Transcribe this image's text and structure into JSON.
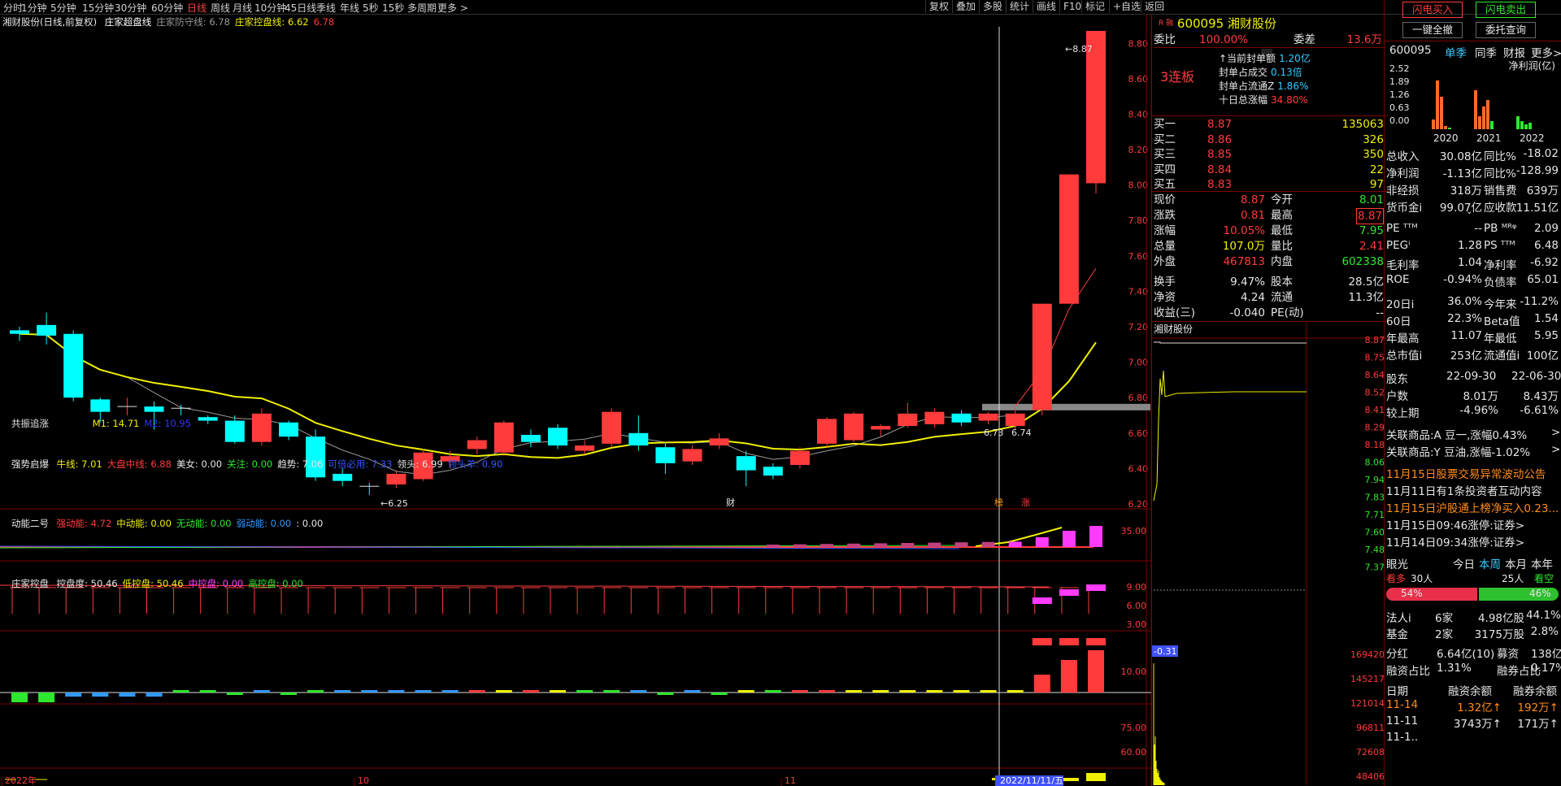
{
  "toolbar": {
    "periods": [
      "分时",
      "1分钟",
      "5分钟",
      "15分钟",
      "30分钟",
      "60分钟",
      "日线",
      "周线",
      "月线",
      "10分钟",
      "45日线",
      "季线",
      "年线",
      "5秒",
      "15秒",
      "多周期",
      "更多 >"
    ],
    "selected": "日线",
    "right_buttons": [
      "复权",
      "叠加",
      "多股",
      "统计",
      "画线",
      "F10",
      "标记",
      "+自选",
      "返回"
    ]
  },
  "chart": {
    "title": "湘财股份(日线,前复权)",
    "ma_legend": [
      {
        "label": "庄家超盘线",
        "color": "#ffffff"
      },
      {
        "label": "庄家防守线: 6.78",
        "color": "#9a9a9a"
      },
      {
        "label": "庄家控盘线: 6.62",
        "color": "#f0f000"
      },
      {
        "label": "6.78",
        "color": "#ff3b3b"
      }
    ],
    "price_axis": [
      "8.80",
      "8.60",
      "8.40",
      "8.20",
      "8.00",
      "7.80",
      "7.60",
      "7.40",
      "7.20",
      "7.00",
      "6.80",
      "6.60",
      "6.40",
      "6.20"
    ],
    "annotations": {
      "high": "8.87",
      "low": "6.25",
      "left_price": "6.73",
      "right_price": "6.74",
      "marker_cai": "财",
      "marker_ban": "榜",
      "marker_zhang": "涨"
    },
    "x_labels": [
      "2022年",
      "10",
      "11"
    ],
    "date_cursor": "2022/11/11/五",
    "period_label": "日线",
    "candles": [
      [
        7.18,
        7.16,
        7.2,
        7.12
      ],
      [
        7.21,
        7.15,
        7.28,
        7.1
      ],
      [
        7.16,
        6.8,
        7.18,
        6.78
      ],
      [
        6.79,
        6.72,
        6.8,
        6.66
      ],
      [
        6.75,
        6.75,
        6.8,
        6.7
      ],
      [
        6.75,
        6.72,
        6.78,
        6.62
      ],
      [
        6.74,
        6.73,
        6.76,
        6.7
      ],
      [
        6.69,
        6.67,
        6.7,
        6.65
      ],
      [
        6.67,
        6.55,
        6.7,
        6.54
      ],
      [
        6.55,
        6.71,
        6.74,
        6.53
      ],
      [
        6.66,
        6.58,
        6.67,
        6.56
      ],
      [
        6.58,
        6.35,
        6.62,
        6.33
      ],
      [
        6.37,
        6.33,
        6.4,
        6.3
      ],
      [
        6.3,
        6.29,
        6.32,
        6.25
      ],
      [
        6.31,
        6.37,
        6.39,
        6.29
      ],
      [
        6.34,
        6.49,
        6.51,
        6.33
      ],
      [
        6.44,
        6.47,
        6.5,
        6.4
      ],
      [
        6.51,
        6.56,
        6.58,
        6.48
      ],
      [
        6.49,
        6.66,
        6.67,
        6.47
      ],
      [
        6.59,
        6.55,
        6.62,
        6.52
      ],
      [
        6.63,
        6.53,
        6.65,
        6.51
      ],
      [
        6.5,
        6.53,
        6.56,
        6.48
      ],
      [
        6.54,
        6.72,
        6.74,
        6.52
      ],
      [
        6.6,
        6.53,
        6.7,
        6.5
      ],
      [
        6.52,
        6.43,
        6.55,
        6.37
      ],
      [
        6.44,
        6.51,
        6.53,
        6.42
      ],
      [
        6.53,
        6.57,
        6.6,
        6.51
      ],
      [
        6.47,
        6.39,
        6.5,
        6.3
      ],
      [
        6.41,
        6.36,
        6.43,
        6.34
      ],
      [
        6.42,
        6.5,
        6.52,
        6.4
      ],
      [
        6.54,
        6.68,
        6.69,
        6.52
      ],
      [
        6.56,
        6.71,
        6.72,
        6.55
      ],
      [
        6.62,
        6.64,
        6.65,
        6.58
      ],
      [
        6.64,
        6.71,
        6.77,
        6.63
      ],
      [
        6.65,
        6.72,
        6.74,
        6.63
      ],
      [
        6.71,
        6.66,
        6.73,
        6.64
      ],
      [
        6.67,
        6.71,
        6.72,
        6.65
      ],
      [
        6.64,
        6.71,
        6.74,
        6.62
      ],
      [
        6.73,
        7.33,
        7.33,
        6.7
      ],
      [
        7.33,
        8.06,
        8.06,
        7.33
      ],
      [
        8.01,
        8.87,
        8.87,
        7.95
      ]
    ]
  },
  "indicators": {
    "p1": {
      "name": "共振追涨",
      "items": [
        {
          "t": "M1: 14.71",
          "c": "#f0f000"
        },
        {
          "t": "M2: 10.95",
          "c": "#3333ff"
        }
      ],
      "axis": [
        "35.00"
      ]
    },
    "p2": {
      "name": "强势启爆",
      "items": [
        {
          "t": "牛线: 7.01",
          "c": "#f0f000"
        },
        {
          "t": "大盘中线: 6.88",
          "c": "#ff3b3b"
        },
        {
          "t": "美女: 0.00",
          "c": "#e6e6e6"
        },
        {
          "t": "关注: 0.00",
          "c": "#2ee82e"
        },
        {
          "t": "趋势: 7.06",
          "c": "#e6e6e6"
        },
        {
          "t": "可倍必用: 7.33",
          "c": "#3355ff"
        },
        {
          "t": "领头: 6.99",
          "c": "#e6e6e6"
        },
        {
          "t": "领头羊: 0.90",
          "c": "#3355ff"
        }
      ],
      "axis": [
        "9.00",
        "6.00",
        "3.00"
      ]
    },
    "p3": {
      "name": "动能二号",
      "items": [
        {
          "t": "强动能: 4.72",
          "c": "#ff3b3b"
        },
        {
          "t": "中动能: 0.00",
          "c": "#f0f000"
        },
        {
          "t": "无动能: 0.00",
          "c": "#2ee82e"
        },
        {
          "t": "弱动能: 0.00",
          "c": "#3399ff"
        },
        {
          "t": ": 0.00",
          "c": "#e6e6e6"
        }
      ],
      "axis": [
        "10.00"
      ]
    },
    "p4": {
      "name": "庄家控盘",
      "items": [
        {
          "t": "控盘度: 50.46",
          "c": "#e6e6e6"
        },
        {
          "t": "低控盘: 50.46",
          "c": "#f0f000"
        },
        {
          "t": "中控盘: 0.00",
          "c": "#ff3bff"
        },
        {
          "t": "高控盘: 0.00",
          "c": "#2ee82e"
        }
      ],
      "axis": [
        "75.00",
        "60.00"
      ]
    }
  },
  "quote": {
    "code": "600095",
    "name": "湘财股份",
    "marker": "R 融",
    "weibi_label": "委比",
    "weibi": "100.00%",
    "weicha_label": "委差",
    "weicha": "13.6万",
    "lianban": "3连板",
    "seal": [
      {
        "k": "↑当前封单额",
        "v": "1.20亿"
      },
      {
        "k": "封单占成交",
        "v": "0.13倍"
      },
      {
        "k": "封单占流通Z",
        "v": "1.86%"
      },
      {
        "k": "十日总涨幅",
        "v": "34.80%"
      }
    ],
    "bids": [
      {
        "k": "买一",
        "p": "8.87",
        "v": "135063"
      },
      {
        "k": "买二",
        "p": "8.86",
        "v": "326"
      },
      {
        "k": "买三",
        "p": "8.85",
        "v": "350"
      },
      {
        "k": "买四",
        "p": "8.84",
        "v": "22"
      },
      {
        "k": "买五",
        "p": "8.83",
        "v": "97"
      }
    ],
    "stats": [
      {
        "k1": "现价",
        "v1": "8.87",
        "k2": "今开",
        "v2": "8.01"
      },
      {
        "k1": "涨跌",
        "v1": "0.81",
        "k2": "最高",
        "v2": "8.87"
      },
      {
        "k1": "涨幅",
        "v1": "10.05%",
        "k2": "最低",
        "v2": "7.95"
      },
      {
        "k1": "总量",
        "v1": "107.0万",
        "k2": "量比",
        "v2": "2.41"
      },
      {
        "k1": "外盘",
        "v1": "467813",
        "k2": "内盘",
        "v2": "602338"
      },
      {
        "k1": "换手",
        "v1": "9.47%",
        "k2": "股本",
        "v2": "28.5亿"
      },
      {
        "k1": "净资",
        "v1": "4.24",
        "k2": "流通",
        "v2": "11.3亿"
      },
      {
        "k1": "收益(三)",
        "v1": "-0.040",
        "k2": "PE(动)",
        "v2": "--"
      }
    ],
    "mini_title": "湘财股份",
    "mini_axis": [
      "8.87",
      "8.75",
      "8.64",
      "8.52",
      "8.41",
      "8.29",
      "8.18",
      "8.06",
      "7.94",
      "7.83",
      "7.71",
      "7.60",
      "7.48",
      "7.37"
    ],
    "vol_axis": [
      "169420",
      "145217",
      "121014",
      "96811",
      "72608",
      "48406",
      "24203"
    ],
    "mini_tag": "-0.31"
  },
  "fin": {
    "btn_buy": "闪电买入",
    "btn_sell": "闪电卖出",
    "btn_clear": "一键全撤",
    "btn_query": "委托查询",
    "tabs": [
      "600095",
      "单季",
      "同季",
      "财报",
      "更多>>"
    ],
    "chart_caption": "净利润(亿)",
    "chart_axis": [
      "2.52",
      "1.89",
      "1.26",
      "0.63",
      "0.00"
    ],
    "chart_years": [
      "2020",
      "2021",
      "2022"
    ],
    "rows1": [
      {
        "a": "总收入",
        "b": "30.08亿",
        "c": "同比%",
        "d": "-18.02"
      },
      {
        "a": "净利润",
        "b": "-1.13亿",
        "c": "同比%",
        "d": "-128.99"
      },
      {
        "a": "非经损",
        "b": "318万",
        "c": "销售费",
        "d": "639万"
      },
      {
        "a": "货币金i",
        "b": "99.07亿",
        "c": "应收款",
        "d": "11.51亿"
      }
    ],
    "rows2": [
      {
        "a": "PE ᵀᵀᴹ",
        "b": "--",
        "c": "PB ᴹᴿᵠ",
        "d": "2.09"
      },
      {
        "a": "PEGⁱ",
        "b": "1.28",
        "c": "PS ᵀᵀᴹ",
        "d": "6.48"
      },
      {
        "a": "毛利率",
        "b": "1.04",
        "c": "净利率",
        "d": "-6.92"
      },
      {
        "a": "ROE",
        "b": "-0.94%",
        "c": "负债率",
        "d": "65.01"
      }
    ],
    "rows3": [
      {
        "a": "20日i",
        "b": "36.0%",
        "c": "今年来",
        "d": "-11.2%"
      },
      {
        "a": "60日",
        "b": "22.3%",
        "c": "Beta值",
        "d": "1.54"
      },
      {
        "a": "年最高",
        "b": "11.07",
        "c": "年最低",
        "d": "5.95"
      },
      {
        "a": "总市值i",
        "b": "253亿",
        "c": "流通值i",
        "d": "100亿"
      }
    ],
    "holders_head": {
      "a": "股东",
      "b": "22-09-30",
      "c": "22-06-30"
    },
    "holders": [
      {
        "a": "户数",
        "b": "8.01万",
        "c": "8.43万"
      },
      {
        "a": "较上期",
        "b": "-4.96%",
        "c": "-6.61%"
      }
    ],
    "related": [
      "关联商品:A 豆一,涨幅0.43%",
      "关联商品:Y 豆油,涨幅-1.02%"
    ],
    "news": [
      "11月15日股票交易异常波动公告",
      "11月11日有1条投资者互动内容",
      "11月15日沪股通上榜净买入0.23...",
      "11月15日09:46涨停:证券>",
      "11月14日09:34涨停:证券>"
    ],
    "eye": {
      "label": "眼光",
      "tabs": [
        "今日",
        "本周",
        "本月",
        "本年"
      ],
      "bull": "看多",
      "bull_n": "30人",
      "bear_n": "25人",
      "bear": "看空",
      "bull_pct": "54%",
      "bear_pct": "46%"
    },
    "inst": [
      {
        "a": "法人i",
        "b": "6家",
        "c": "4.98亿股",
        "d": "44.1%"
      },
      {
        "a": "基金",
        "b": "2家",
        "c": "3175万股",
        "d": "2.8%"
      }
    ],
    "div": {
      "a": "分红",
      "b": "6.64亿(10)",
      "c": "募资",
      "d": "138亿(5)"
    },
    "margin": {
      "a": "融资占比",
      "b": "1.31%",
      "c": "融券占比",
      "d": "0.17%"
    },
    "margin_head": {
      "a": "日期",
      "b": "融资余额",
      "c": "融券余额"
    },
    "margin_rows": [
      {
        "a": "11-14",
        "b": "1.32亿↑",
        "c": "192万↑"
      },
      {
        "a": "11-11",
        "b": "3743万↑",
        "c": "171万↑"
      },
      {
        "a": "11-1..",
        "b": "",
        "c": ""
      }
    ]
  }
}
